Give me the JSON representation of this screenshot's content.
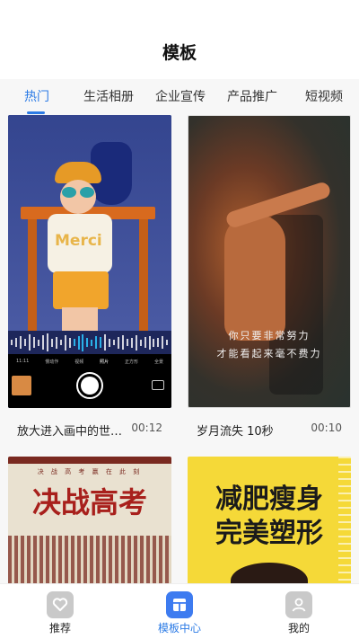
{
  "header": {
    "title": "模板"
  },
  "tabs": [
    {
      "label": "热门",
      "active": true
    },
    {
      "label": "生活相册",
      "active": false
    },
    {
      "label": "企业宣传",
      "active": false
    },
    {
      "label": "产品推广",
      "active": false
    },
    {
      "label": "短视频",
      "active": false
    }
  ],
  "templates": [
    {
      "title": "放大进入画中的世…",
      "duration": "00:12",
      "shirt_text": "Merci",
      "camera_modes": [
        "11:11",
        "慢动作",
        "视频",
        "照片",
        "正方形",
        "全景"
      ],
      "selected_mode": "照片"
    },
    {
      "title": "岁月流失 10秒",
      "duration": "00:10",
      "quote_line1": "你只要非常努力",
      "quote_line2": "才能看起来毫不费力"
    },
    {
      "poster_top": "决 战 高 考   赢 在 此 刻",
      "poster_title": "决战高考"
    },
    {
      "poster_line1": "减肥瘦身",
      "poster_line2": "完美塑形"
    }
  ],
  "bottom_nav": [
    {
      "label": "推荐",
      "icon": "heart-icon",
      "active": false
    },
    {
      "label": "模板中心",
      "icon": "template-icon",
      "active": true
    },
    {
      "label": "我的",
      "icon": "user-icon",
      "active": false
    }
  ],
  "colors": {
    "accent": "#2c7be5",
    "nav_active_bg": "#3d7bf0",
    "nav_inactive_bg": "#c9c9c9",
    "tab_bar_bg": "#f7f7f7"
  }
}
